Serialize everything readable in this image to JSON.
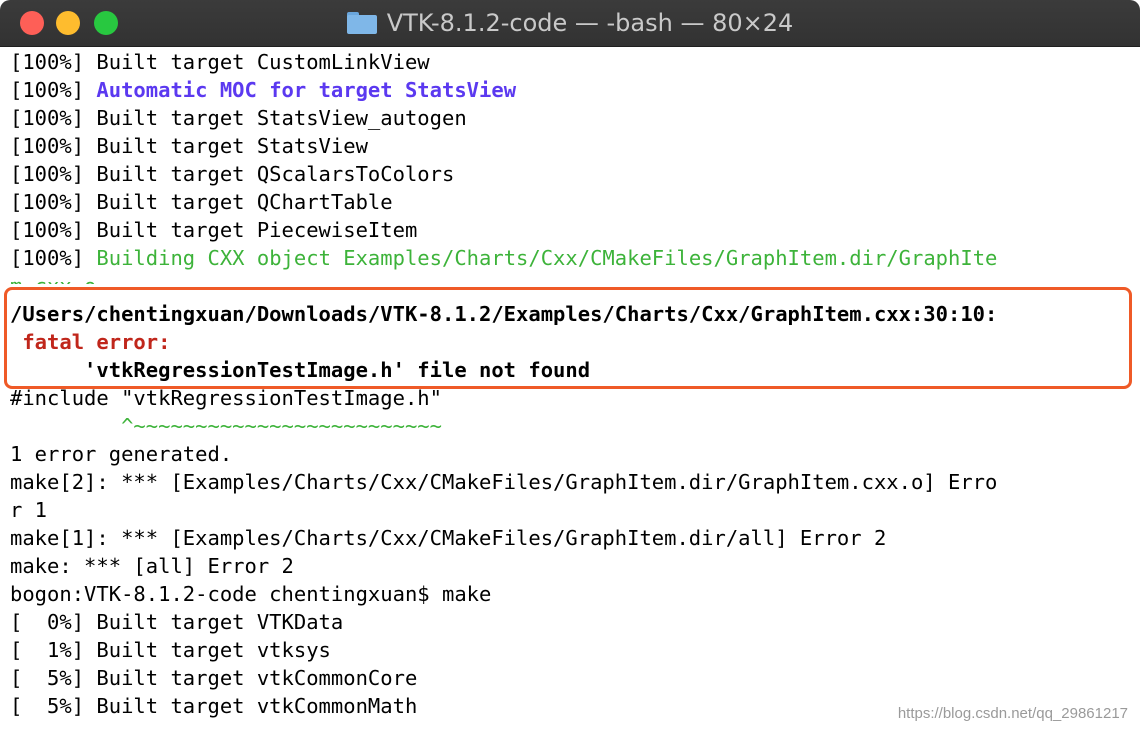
{
  "window": {
    "title": "VTK-8.1.2-code — -bash — 80×24"
  },
  "colors": {
    "blue_text": "#5b39f0",
    "green_text": "#3db33a",
    "red_text": "#c0261b",
    "highlight_border": "#ef5a27"
  },
  "terminal": {
    "lines": [
      {
        "text": "[100%] Built target CustomLinkView"
      },
      {
        "prefix": "[100%] ",
        "text": "Automatic MOC for target StatsView"
      },
      {
        "text": "[100%] Built target StatsView_autogen"
      },
      {
        "text": "[100%] Built target StatsView"
      },
      {
        "text": "[100%] Built target QScalarsToColors"
      },
      {
        "text": "[100%] Built target QChartTable"
      },
      {
        "text": "[100%] Built target PiecewiseItem"
      },
      {
        "prefix": "[100%] ",
        "text": "Building CXX object Examples/Charts/Cxx/CMakeFiles/GraphItem.dir/GraphIte"
      },
      {
        "text": "m.cxx.o"
      },
      {
        "text": "/Users/chentingxuan/Downloads/VTK-8.1.2/Examples/Charts/Cxx/GraphItem.cxx:30:10:"
      },
      {
        "text": " fatal error:"
      },
      {
        "text": "      'vtkRegressionTestImage.h' file not found"
      },
      {
        "text": "#include \"vtkRegressionTestImage.h\""
      },
      {
        "text": "         ^~~~~~~~~~~~~~~~~~~~~~~~~~"
      },
      {
        "text": "1 error generated."
      },
      {
        "text": "make[2]: *** [Examples/Charts/Cxx/CMakeFiles/GraphItem.dir/GraphItem.cxx.o] Erro"
      },
      {
        "text": "r 1"
      },
      {
        "text": "make[1]: *** [Examples/Charts/Cxx/CMakeFiles/GraphItem.dir/all] Error 2"
      },
      {
        "text": "make: *** [all] Error 2"
      },
      {
        "text": "bogon:VTK-8.1.2-code chentingxuan$ make"
      },
      {
        "text": "[  0%] Built target VTKData"
      },
      {
        "text": "[  1%] Built target vtksys"
      },
      {
        "text": "[  5%] Built target vtkCommonCore"
      },
      {
        "text": "[  5%] Built target vtkCommonMath"
      }
    ]
  },
  "watermark": "https://blog.csdn.net/qq_29861217"
}
